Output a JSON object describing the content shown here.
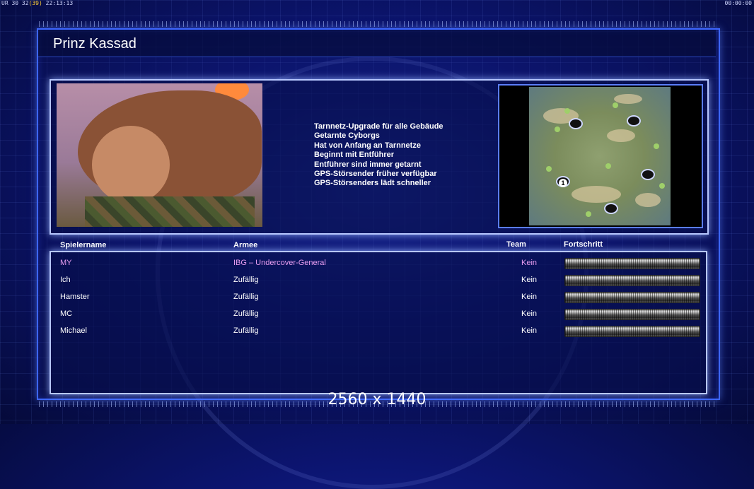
{
  "hud": {
    "top_left_prefix": "UR 30 32",
    "top_left_highlight": "(39)",
    "top_left_time": "22:13:13",
    "top_right_time": "00:00:00"
  },
  "general_title": "Prinz Kassad",
  "traits": [
    "Tarnnetz-Upgrade für alle Gebäude",
    "Getarnte Cyborgs",
    "Hat von Anfang an Tarnnetze",
    "Beginnt mit Entführer",
    "Entführer sind immer getarnt",
    "GPS-Störsender früher verfügbar",
    "GPS-Störsenders lädt schneller"
  ],
  "map": {
    "player_marker": "1"
  },
  "columns": {
    "player": "Spielername",
    "army": "Armee",
    "team": "Team",
    "progress": "Fortschritt"
  },
  "players": [
    {
      "name": "MY",
      "army": "IBG – Undercover-General",
      "team": "Kein",
      "highlight": true
    },
    {
      "name": "Ich",
      "army": "Zufällig",
      "team": "Kein",
      "highlight": false
    },
    {
      "name": "Hamster",
      "army": "Zufällig",
      "team": "Kein",
      "highlight": false
    },
    {
      "name": "MC",
      "army": "Zufällig",
      "team": "Kein",
      "highlight": false
    },
    {
      "name": "Michael",
      "army": "Zufällig",
      "team": "Kein",
      "highlight": false
    }
  ],
  "resolution": "2560 x 1440",
  "colors": {
    "accent_frame": "#3d66ff",
    "panel_border": "#b7c7ff",
    "highlight_text": "#e79df0"
  }
}
